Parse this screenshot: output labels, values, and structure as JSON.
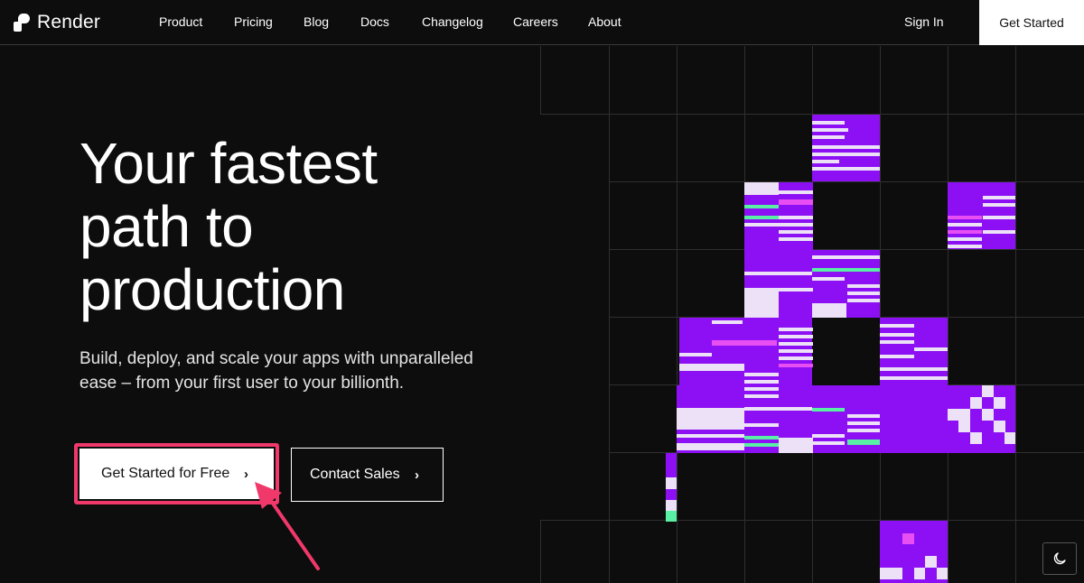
{
  "nav": {
    "brand": "Render",
    "links": [
      "Product",
      "Pricing",
      "Blog",
      "Docs",
      "Changelog",
      "Careers",
      "About"
    ],
    "sign_in": "Sign In",
    "get_started": "Get Started"
  },
  "hero": {
    "headline_line1": "Your fastest",
    "headline_line2": "path to",
    "headline_line3": "production",
    "subtitle": "Build, deploy, and scale your apps with unparalleled ease – from your first user to your billionth.",
    "primary_cta": "Get Started for Free",
    "secondary_cta": "Contact Sales"
  },
  "icons": {
    "cta_chevron": "chevron-right-icon",
    "theme_toggle": "moon-icon",
    "annotation": "arrow-pointer"
  },
  "colors": {
    "background": "#0d0d0d",
    "accent_purple": "#8c10f3",
    "accent_lavender": "#ece1f7",
    "accent_magenta": "#e84ff2",
    "accent_green": "#59f0a5",
    "highlight": "#f0386b"
  }
}
